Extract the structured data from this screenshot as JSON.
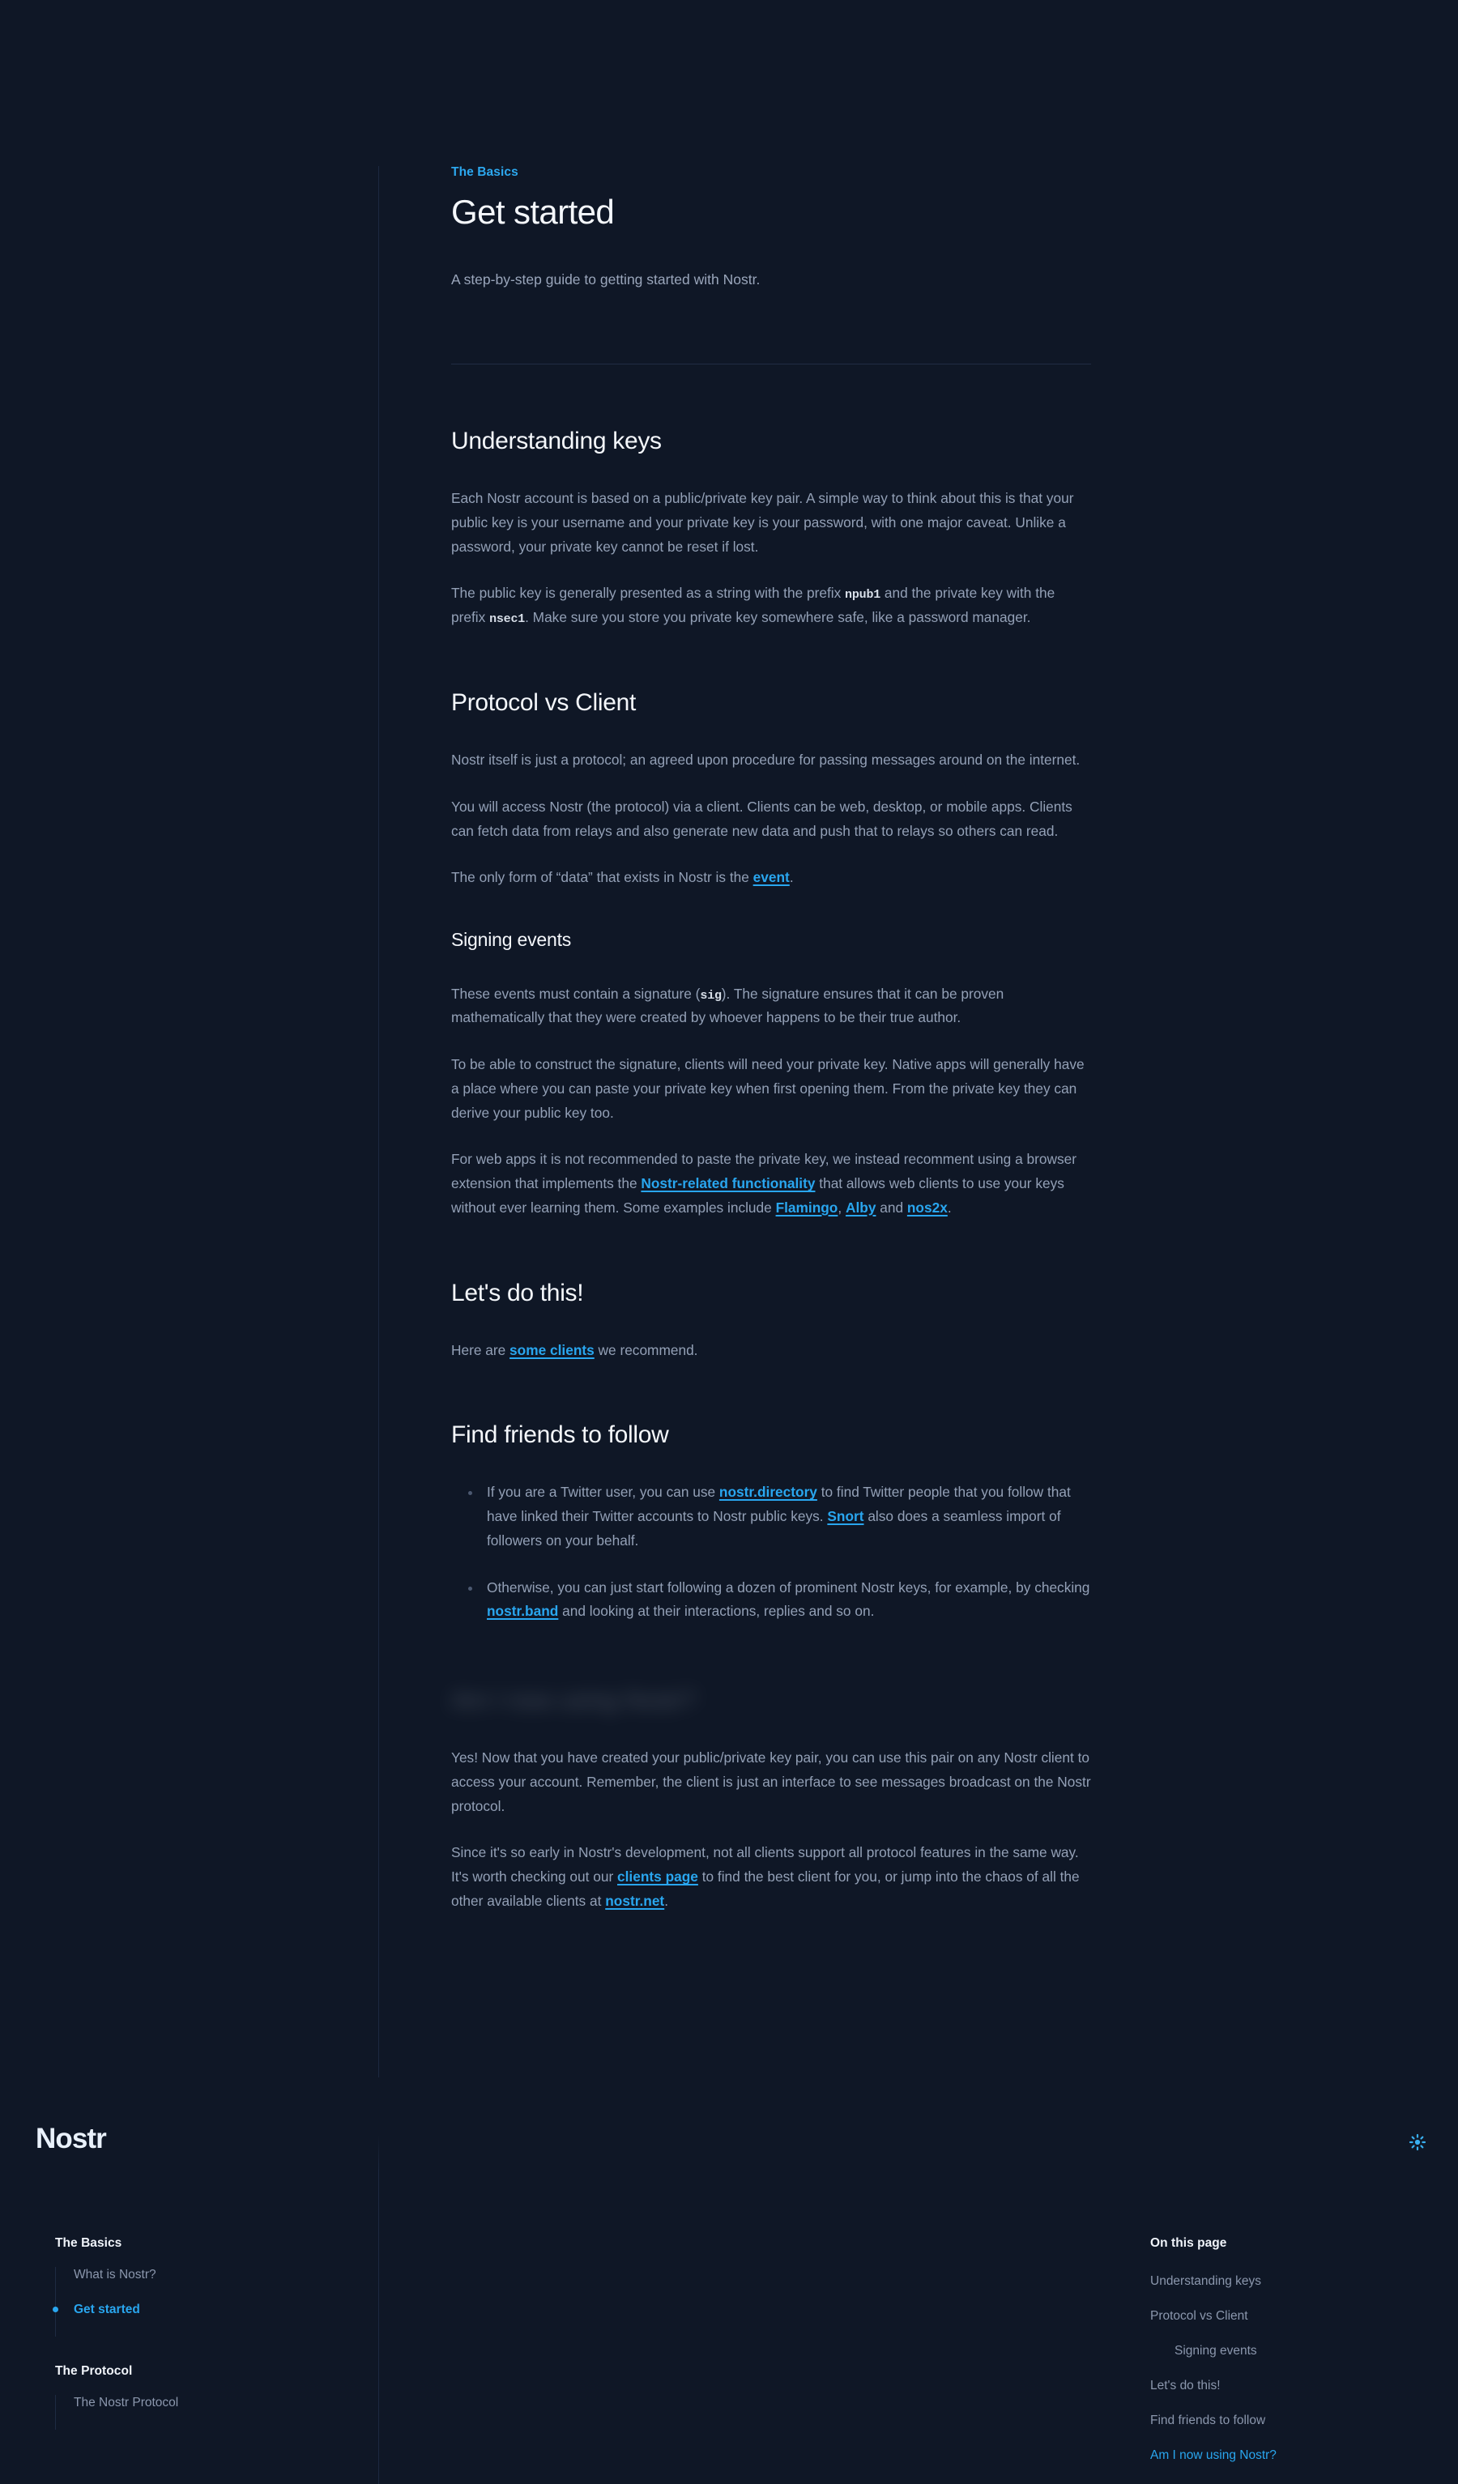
{
  "colors": {
    "background": "#0f1726",
    "accent": "#29a6ef",
    "heading": "#f4f7fb",
    "body_text": "#93a0b6",
    "divider": "#1c2840"
  },
  "brand": {
    "name": "Nostr"
  },
  "theme_toggle": {
    "icon": "sun-icon",
    "label": "Toggle light mode"
  },
  "article": {
    "eyebrow": "The Basics",
    "title": "Get started",
    "lede": "A step-by-step guide to getting started with Nostr.",
    "sections": [
      {
        "heading": "Understanding keys",
        "paragraphs": [
          {
            "parts": [
              {
                "type": "text",
                "text": "Each Nostr account is based on a public/private key pair. A simple way to think about this is that your public key is your username and your private key is your password, with one major caveat. Unlike a password, your private key cannot be reset if lost."
              }
            ]
          },
          {
            "parts": [
              {
                "type": "text",
                "text": "The public key is generally presented as a string with the prefix "
              },
              {
                "type": "code",
                "text": "npub1"
              },
              {
                "type": "text",
                "text": " and the private key with the prefix "
              },
              {
                "type": "code",
                "text": "nsec1"
              },
              {
                "type": "text",
                "text": ". Make sure you store you private key somewhere safe, like a password manager."
              }
            ]
          }
        ]
      },
      {
        "heading": "Protocol vs Client",
        "paragraphs": [
          {
            "parts": [
              {
                "type": "text",
                "text": "Nostr itself is just a protocol; an agreed upon procedure for passing messages around on the internet."
              }
            ]
          },
          {
            "parts": [
              {
                "type": "text",
                "text": "You will access Nostr (the protocol) via a client. Clients can be web, desktop, or mobile apps. Clients can fetch data from relays and also generate new data and push that to relays so others can read."
              }
            ]
          },
          {
            "parts": [
              {
                "type": "text",
                "text": "The only form of “data” that exists in Nostr is the "
              },
              {
                "type": "link",
                "text": "event"
              },
              {
                "type": "text",
                "text": "."
              }
            ]
          }
        ],
        "subsections": [
          {
            "heading": "Signing events",
            "paragraphs": [
              {
                "parts": [
                  {
                    "type": "text",
                    "text": "These events must contain a signature ("
                  },
                  {
                    "type": "code",
                    "text": "sig"
                  },
                  {
                    "type": "text",
                    "text": "). The signature ensures that it can be proven mathematically that they were created by whoever happens to be their true author."
                  }
                ]
              },
              {
                "parts": [
                  {
                    "type": "text",
                    "text": "To be able to construct the signature, clients will need your private key. Native apps will generally have a place where you can paste your private key when first opening them. From the private key they can derive your public key too."
                  }
                ]
              },
              {
                "parts": [
                  {
                    "type": "text",
                    "text": "For web apps it is not recommended to paste the private key, we instead recomment using a browser extension that implements the "
                  },
                  {
                    "type": "link",
                    "text": "Nostr-related functionality"
                  },
                  {
                    "type": "text",
                    "text": " that allows web clients to use your keys without ever learning them. Some examples include "
                  },
                  {
                    "type": "link",
                    "text": "Flamingo"
                  },
                  {
                    "type": "text",
                    "text": ", "
                  },
                  {
                    "type": "link",
                    "text": "Alby"
                  },
                  {
                    "type": "text",
                    "text": " and "
                  },
                  {
                    "type": "link",
                    "text": "nos2x"
                  },
                  {
                    "type": "text",
                    "text": "."
                  }
                ]
              }
            ]
          }
        ]
      },
      {
        "heading": "Let's do this!",
        "paragraphs": [
          {
            "parts": [
              {
                "type": "text",
                "text": "Here are "
              },
              {
                "type": "link",
                "text": "some clients"
              },
              {
                "type": "text",
                "text": " we recommend."
              }
            ]
          }
        ]
      },
      {
        "heading": "Find friends to follow",
        "bullets": [
          {
            "parts": [
              {
                "type": "text",
                "text": "If you are a Twitter user, you can use "
              },
              {
                "type": "link",
                "text": "nostr.directory"
              },
              {
                "type": "text",
                "text": " to find Twitter people that you follow that have linked their Twitter accounts to Nostr public keys. "
              },
              {
                "type": "link",
                "text": "Snort"
              },
              {
                "type": "text",
                "text": " also does a seamless import of followers on your behalf."
              }
            ]
          },
          {
            "parts": [
              {
                "type": "text",
                "text": "Otherwise, you can just start following a dozen of prominent Nostr keys, for example, by checking "
              },
              {
                "type": "link",
                "text": "nostr.band"
              },
              {
                "type": "text",
                "text": " and looking at their interactions, replies and so on."
              }
            ]
          }
        ]
      },
      {
        "heading": "Am I now using Nostr?",
        "obscured": true,
        "paragraphs": [
          {
            "parts": [
              {
                "type": "text",
                "text": "Yes! Now that you have created your public/private key pair, you can use this pair on any Nostr client to access your account. Remember, the client is just an interface to see messages broadcast on the Nostr protocol."
              }
            ]
          },
          {
            "parts": [
              {
                "type": "text",
                "text": "Since it's so early in Nostr's development, not all clients support all protocol features in the same way. It's worth checking out our "
              },
              {
                "type": "link",
                "text": "clients page"
              },
              {
                "type": "text",
                "text": " to find the best client for you, or jump into the chaos of all the other available clients at "
              },
              {
                "type": "link",
                "text": "nostr.net"
              },
              {
                "type": "text",
                "text": "."
              }
            ]
          }
        ]
      }
    ]
  },
  "sidebar": {
    "groups": [
      {
        "title": "The Basics",
        "items": [
          {
            "label": "What is Nostr?",
            "active": false
          },
          {
            "label": "Get started",
            "active": true
          }
        ]
      },
      {
        "title": "The Protocol",
        "items": [
          {
            "label": "The Nostr Protocol",
            "active": false
          }
        ]
      }
    ]
  },
  "toc": {
    "title": "On this page",
    "items": [
      {
        "label": "Understanding keys",
        "indent": false,
        "active": false
      },
      {
        "label": "Protocol vs Client",
        "indent": false,
        "active": false
      },
      {
        "label": "Signing events",
        "indent": true,
        "active": false
      },
      {
        "label": "Let's do this!",
        "indent": false,
        "active": false
      },
      {
        "label": "Find friends to follow",
        "indent": false,
        "active": false
      },
      {
        "label": "Am I now using Nostr?",
        "indent": false,
        "active": true
      }
    ]
  }
}
